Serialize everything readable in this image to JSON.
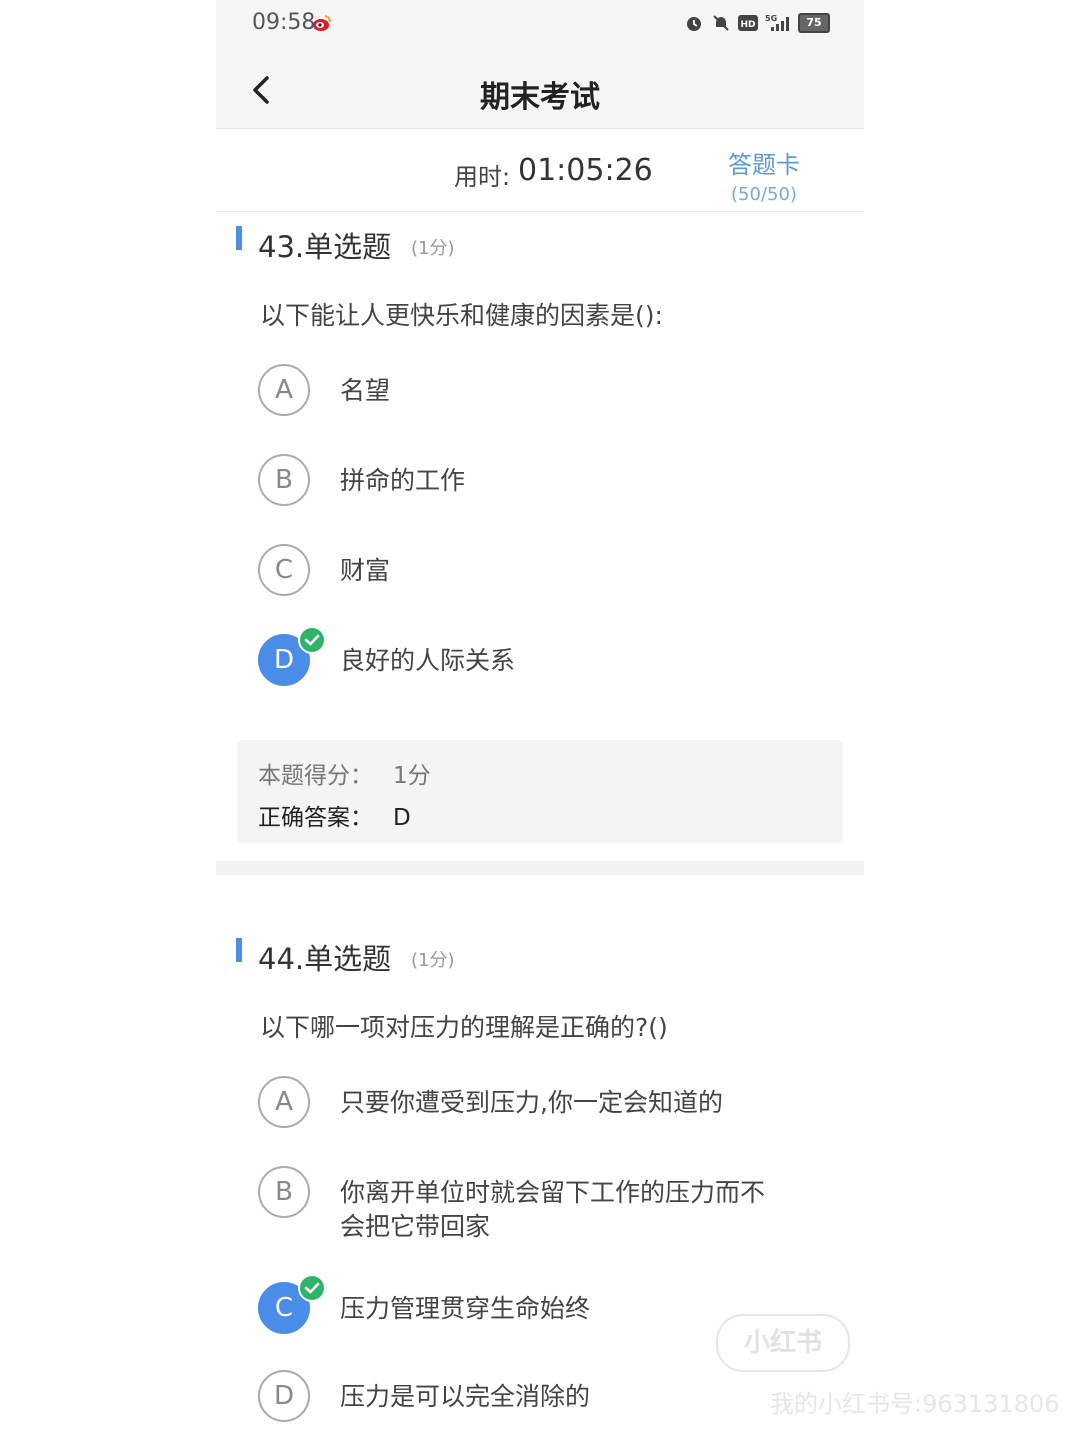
{
  "status_bar": {
    "time": "09:58",
    "battery": "75"
  },
  "header": {
    "title": "期末考试"
  },
  "timer": {
    "label": "用时:",
    "value": "01:05:26"
  },
  "answer_card": {
    "label": "答题卡",
    "count": "(50/50)"
  },
  "questions": [
    {
      "number": "43.单选题",
      "score": "(1分)",
      "text": "以下能让人更快乐和健康的因素是():",
      "options": [
        {
          "letter": "A",
          "text": "名望"
        },
        {
          "letter": "B",
          "text": "拼命的工作"
        },
        {
          "letter": "C",
          "text": "财富"
        },
        {
          "letter": "D",
          "text": "良好的人际关系",
          "selected": true
        }
      ],
      "result": {
        "score_label": "本题得分：",
        "score_value": "1分",
        "answer_label": "正确答案：",
        "answer_value": "D"
      }
    },
    {
      "number": "44.单选题",
      "score": "(1分)",
      "text": "以下哪一项对压力的理解是正确的?()",
      "options": [
        {
          "letter": "A",
          "text": "只要你遭受到压力,你一定会知道的"
        },
        {
          "letter": "B",
          "text_line1": "你离开单位时就会留下工作的压力而不",
          "text_line2": "会把它带回家"
        },
        {
          "letter": "C",
          "text": "压力管理贯穿生命始终",
          "selected": true
        },
        {
          "letter": "D",
          "text": "压力是可以完全消除的"
        }
      ]
    }
  ],
  "watermark": {
    "logo": "小红书",
    "text": "我的小红书号:963131806"
  }
}
